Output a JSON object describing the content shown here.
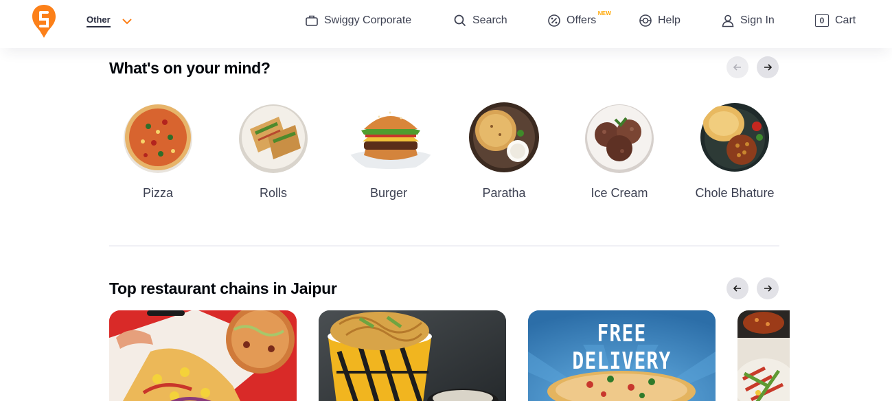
{
  "header": {
    "location_label": "Other",
    "nav": {
      "corporate": "Swiggy Corporate",
      "search": "Search",
      "offers": "Offers",
      "offers_badge": "NEW",
      "help": "Help",
      "signin": "Sign In",
      "cart": "Cart",
      "cart_count": "0"
    }
  },
  "mind": {
    "title": "What's on your mind?",
    "items": [
      {
        "label": "Pizza"
      },
      {
        "label": "Rolls"
      },
      {
        "label": "Burger"
      },
      {
        "label": "Paratha"
      },
      {
        "label": "Ice Cream"
      },
      {
        "label": "Chole Bhature"
      }
    ]
  },
  "chains": {
    "title": "Top restaurant chains in Jaipur",
    "promo_text": "FREE DELIVERY"
  },
  "colors": {
    "brand": "#fc8019",
    "badge": "#ffa700"
  }
}
